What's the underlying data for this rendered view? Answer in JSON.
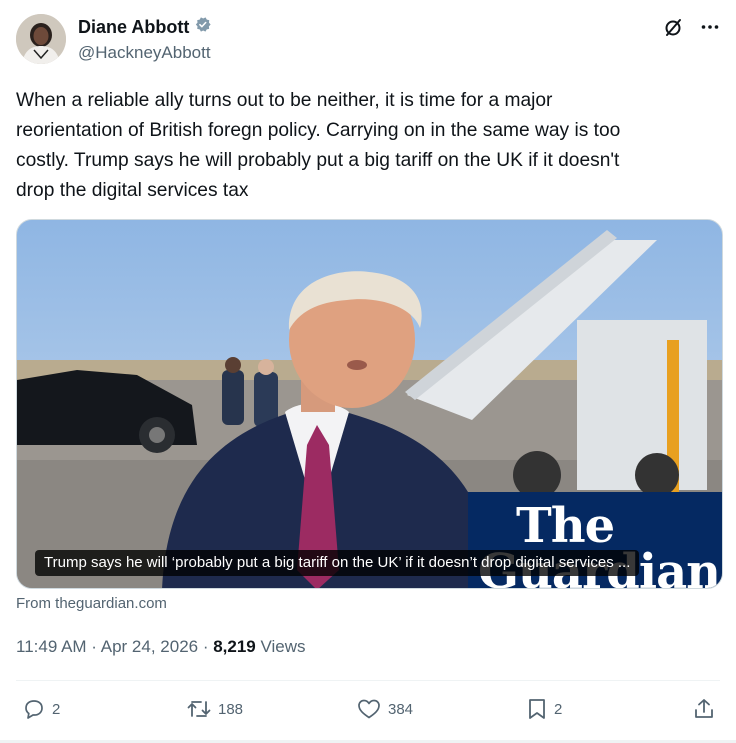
{
  "author": {
    "display_name": "Diane Abbott",
    "handle": "@HackneyAbbott",
    "verified": true,
    "avatar_icon": "profile-photo"
  },
  "header_actions": {
    "grok_icon": "slash-circle-icon",
    "more_icon": "more-icon"
  },
  "tweet": {
    "text": "When a reliable ally turns out to be neither, it is time for a major\nreorientation of British foregn policy. Carrying on in the same way is too\ncostly. Trump says he will probably put a big tariff on the UK if it doesn't\ndrop the digital services tax"
  },
  "card": {
    "watermark_line1": "The",
    "watermark_line2": "Guardian",
    "caption": "Trump says he will ‘probably put a big tariff on the UK’ if it doesn’t drop digital services ...",
    "source": "From theguardian.com"
  },
  "meta": {
    "time": "11:49 AM",
    "separator1": " · ",
    "date": "Apr 24, 2026",
    "separator2": " · ",
    "views_count": "8,219",
    "views_label": " Views"
  },
  "actions": {
    "replies": "2",
    "retweets": "188",
    "likes": "384",
    "bookmarks": "2"
  },
  "colors": {
    "text_primary": "#0f1419",
    "text_secondary": "#536471",
    "verified_badge": "#829aab",
    "guardian_blue": "#052962",
    "divider": "#eff3f4"
  }
}
